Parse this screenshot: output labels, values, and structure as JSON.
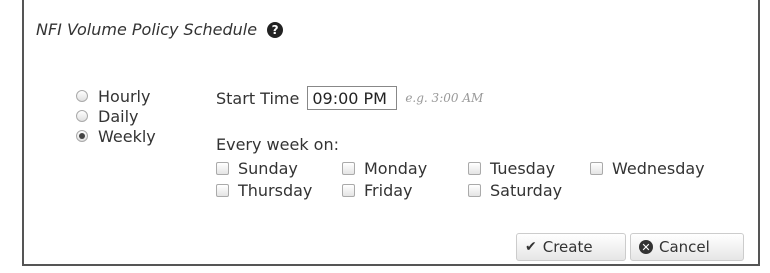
{
  "dialog": {
    "title": "NFI Volume Policy Schedule",
    "help_icon": "question-circle-icon"
  },
  "frequency": {
    "options": [
      {
        "label": "Hourly",
        "checked": false
      },
      {
        "label": "Daily",
        "checked": false
      },
      {
        "label": "Weekly",
        "checked": true
      }
    ],
    "selected": "Weekly"
  },
  "start_time": {
    "label": "Start Time",
    "value": "09:00 PM",
    "hint": "e.g. 3:00 AM"
  },
  "weekly": {
    "label": "Every week on:",
    "days": [
      {
        "label": "Sunday",
        "checked": false
      },
      {
        "label": "Monday",
        "checked": false
      },
      {
        "label": "Tuesday",
        "checked": false
      },
      {
        "label": "Wednesday",
        "checked": false
      },
      {
        "label": "Thursday",
        "checked": false
      },
      {
        "label": "Friday",
        "checked": false
      },
      {
        "label": "Saturday",
        "checked": false
      }
    ]
  },
  "actions": {
    "create_label": "Create",
    "create_icon": "checkmark-icon",
    "cancel_label": "Cancel",
    "cancel_icon": "close-circle-icon"
  }
}
